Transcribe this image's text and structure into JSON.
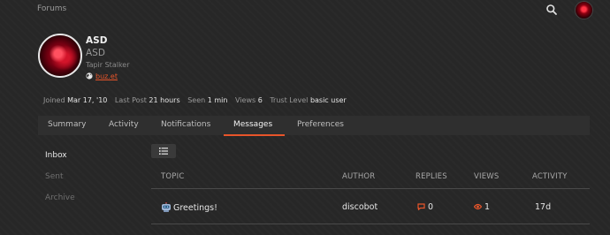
{
  "header": {
    "breadcrumb": "Forums",
    "icons": {
      "search": "search-icon",
      "avatar": "user-avatar"
    }
  },
  "profile": {
    "username": "ASD",
    "full_name": "ASD",
    "title": "Tapir Stalker",
    "website": "buz.et",
    "stats": [
      {
        "label": "Joined",
        "value": "Mar 17, '10"
      },
      {
        "label": "Last Post",
        "value": "21 hours"
      },
      {
        "label": "Seen",
        "value": "1 min"
      },
      {
        "label": "Views",
        "value": "6"
      },
      {
        "label": "Trust Level",
        "value": "basic user"
      }
    ]
  },
  "tabs": [
    "Summary",
    "Activity",
    "Notifications",
    "Messages",
    "Preferences"
  ],
  "active_tab": "Messages",
  "side_nav": [
    "Inbox",
    "Sent",
    "Archive"
  ],
  "active_nav": "Inbox",
  "table": {
    "headers": [
      "TOPIC",
      "AUTHOR",
      "REPLIES",
      "VIEWS",
      "ACTIVITY"
    ],
    "rows": [
      {
        "topic": "Greetings!",
        "author": "discobot",
        "replies": "0",
        "views": "1",
        "activity": "17d"
      }
    ]
  },
  "colors": {
    "accent": "#e8552a",
    "background": "#272727"
  }
}
